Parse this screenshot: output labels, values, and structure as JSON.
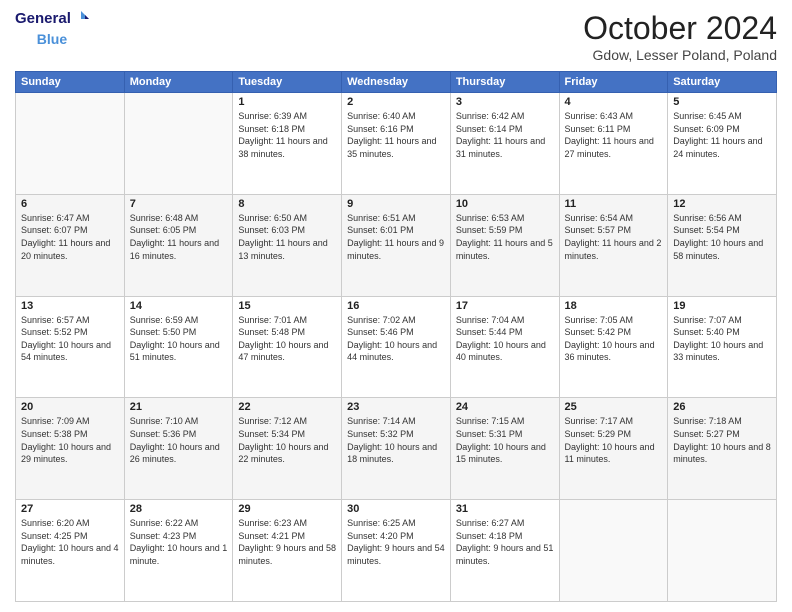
{
  "header": {
    "logo_line1": "General",
    "logo_line2": "Blue",
    "month": "October 2024",
    "location": "Gdow, Lesser Poland, Poland"
  },
  "weekdays": [
    "Sunday",
    "Monday",
    "Tuesday",
    "Wednesday",
    "Thursday",
    "Friday",
    "Saturday"
  ],
  "weeks": [
    [
      {
        "day": "",
        "info": ""
      },
      {
        "day": "",
        "info": ""
      },
      {
        "day": "1",
        "info": "Sunrise: 6:39 AM\nSunset: 6:18 PM\nDaylight: 11 hours and 38 minutes."
      },
      {
        "day": "2",
        "info": "Sunrise: 6:40 AM\nSunset: 6:16 PM\nDaylight: 11 hours and 35 minutes."
      },
      {
        "day": "3",
        "info": "Sunrise: 6:42 AM\nSunset: 6:14 PM\nDaylight: 11 hours and 31 minutes."
      },
      {
        "day": "4",
        "info": "Sunrise: 6:43 AM\nSunset: 6:11 PM\nDaylight: 11 hours and 27 minutes."
      },
      {
        "day": "5",
        "info": "Sunrise: 6:45 AM\nSunset: 6:09 PM\nDaylight: 11 hours and 24 minutes."
      }
    ],
    [
      {
        "day": "6",
        "info": "Sunrise: 6:47 AM\nSunset: 6:07 PM\nDaylight: 11 hours and 20 minutes."
      },
      {
        "day": "7",
        "info": "Sunrise: 6:48 AM\nSunset: 6:05 PM\nDaylight: 11 hours and 16 minutes."
      },
      {
        "day": "8",
        "info": "Sunrise: 6:50 AM\nSunset: 6:03 PM\nDaylight: 11 hours and 13 minutes."
      },
      {
        "day": "9",
        "info": "Sunrise: 6:51 AM\nSunset: 6:01 PM\nDaylight: 11 hours and 9 minutes."
      },
      {
        "day": "10",
        "info": "Sunrise: 6:53 AM\nSunset: 5:59 PM\nDaylight: 11 hours and 5 minutes."
      },
      {
        "day": "11",
        "info": "Sunrise: 6:54 AM\nSunset: 5:57 PM\nDaylight: 11 hours and 2 minutes."
      },
      {
        "day": "12",
        "info": "Sunrise: 6:56 AM\nSunset: 5:54 PM\nDaylight: 10 hours and 58 minutes."
      }
    ],
    [
      {
        "day": "13",
        "info": "Sunrise: 6:57 AM\nSunset: 5:52 PM\nDaylight: 10 hours and 54 minutes."
      },
      {
        "day": "14",
        "info": "Sunrise: 6:59 AM\nSunset: 5:50 PM\nDaylight: 10 hours and 51 minutes."
      },
      {
        "day": "15",
        "info": "Sunrise: 7:01 AM\nSunset: 5:48 PM\nDaylight: 10 hours and 47 minutes."
      },
      {
        "day": "16",
        "info": "Sunrise: 7:02 AM\nSunset: 5:46 PM\nDaylight: 10 hours and 44 minutes."
      },
      {
        "day": "17",
        "info": "Sunrise: 7:04 AM\nSunset: 5:44 PM\nDaylight: 10 hours and 40 minutes."
      },
      {
        "day": "18",
        "info": "Sunrise: 7:05 AM\nSunset: 5:42 PM\nDaylight: 10 hours and 36 minutes."
      },
      {
        "day": "19",
        "info": "Sunrise: 7:07 AM\nSunset: 5:40 PM\nDaylight: 10 hours and 33 minutes."
      }
    ],
    [
      {
        "day": "20",
        "info": "Sunrise: 7:09 AM\nSunset: 5:38 PM\nDaylight: 10 hours and 29 minutes."
      },
      {
        "day": "21",
        "info": "Sunrise: 7:10 AM\nSunset: 5:36 PM\nDaylight: 10 hours and 26 minutes."
      },
      {
        "day": "22",
        "info": "Sunrise: 7:12 AM\nSunset: 5:34 PM\nDaylight: 10 hours and 22 minutes."
      },
      {
        "day": "23",
        "info": "Sunrise: 7:14 AM\nSunset: 5:32 PM\nDaylight: 10 hours and 18 minutes."
      },
      {
        "day": "24",
        "info": "Sunrise: 7:15 AM\nSunset: 5:31 PM\nDaylight: 10 hours and 15 minutes."
      },
      {
        "day": "25",
        "info": "Sunrise: 7:17 AM\nSunset: 5:29 PM\nDaylight: 10 hours and 11 minutes."
      },
      {
        "day": "26",
        "info": "Sunrise: 7:18 AM\nSunset: 5:27 PM\nDaylight: 10 hours and 8 minutes."
      }
    ],
    [
      {
        "day": "27",
        "info": "Sunrise: 6:20 AM\nSunset: 4:25 PM\nDaylight: 10 hours and 4 minutes."
      },
      {
        "day": "28",
        "info": "Sunrise: 6:22 AM\nSunset: 4:23 PM\nDaylight: 10 hours and 1 minute."
      },
      {
        "day": "29",
        "info": "Sunrise: 6:23 AM\nSunset: 4:21 PM\nDaylight: 9 hours and 58 minutes."
      },
      {
        "day": "30",
        "info": "Sunrise: 6:25 AM\nSunset: 4:20 PM\nDaylight: 9 hours and 54 minutes."
      },
      {
        "day": "31",
        "info": "Sunrise: 6:27 AM\nSunset: 4:18 PM\nDaylight: 9 hours and 51 minutes."
      },
      {
        "day": "",
        "info": ""
      },
      {
        "day": "",
        "info": ""
      }
    ]
  ]
}
